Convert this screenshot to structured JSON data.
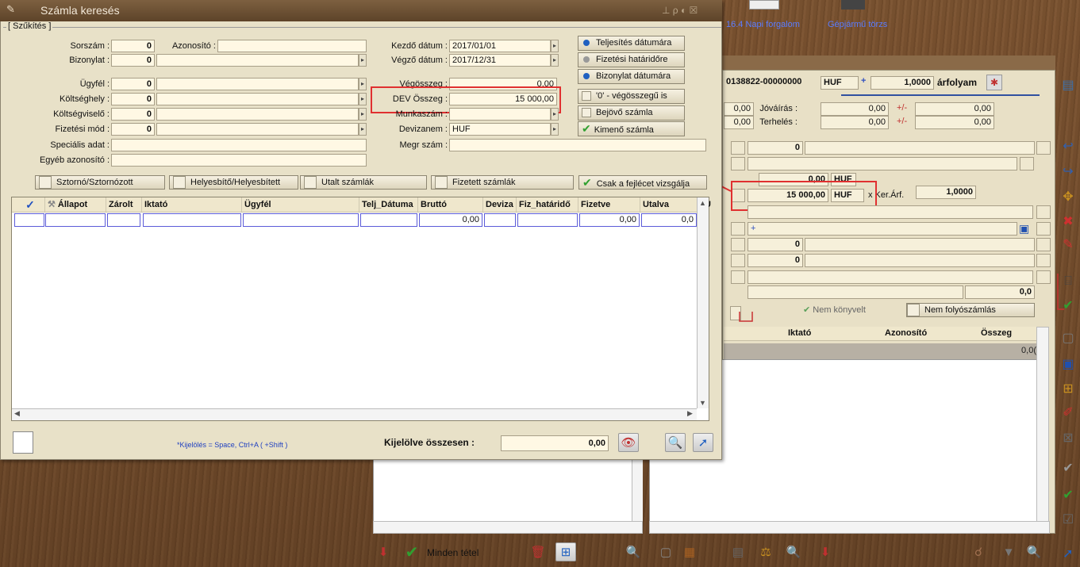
{
  "window": {
    "title": "Számla keresés",
    "ctrls": "⊥ ρ ◐ ☒"
  },
  "bg": {
    "tab1": "16.4 Napi forgalom",
    "tab2": "Gépjármű törzs"
  },
  "szukites": {
    "legend": "[ Szűkítés ]",
    "sorszam_label": "Sorszám :",
    "sorszam": "0",
    "azonosito_label": "Azonosító :",
    "azonosito": "",
    "bizonylat_label": "Bizonylat :",
    "bizonylat": "0",
    "ugyfel_label": "Ügyfél :",
    "ugyfel": "0",
    "koltseghely_label": "Költséghely :",
    "koltseghely": "0",
    "koltsegviselo_label": "Költségviselő :",
    "koltsegviselo": "0",
    "fizmod_label": "Fizetési mód :",
    "fizmod": "0",
    "specialis_label": "Speciális adat :",
    "specialis": "",
    "egyeb_label": "Egyéb azonosító :",
    "egyeb": "",
    "kezdo_label": "Kezdő dátum :",
    "kezdo": "2017/01/01",
    "vegzo_label": "Végző dátum :",
    "vegzo": "2017/12/31",
    "vegosszeg_label": "Végösszeg :",
    "vegosszeg": "0,00",
    "dev_label": "DEV Összeg :",
    "dev": "15 000,00",
    "munkaszam_label": "Munkaszám :",
    "munkaszam": "",
    "devizanem_label": "Devizanem :",
    "devizanem": "HUF",
    "megr_label": "Megr szám :",
    "megr": ""
  },
  "options": {
    "telj": "Teljesítés dátumára",
    "fiz": "Fizetési határidőre",
    "biz": "Bizonylat dátumára",
    "zero": "'0' - végösszegű is",
    "bejovo": "Bejövő számla",
    "kimeno": "Kimenő számla"
  },
  "filters": {
    "storno": "Sztornó/Sztornózott",
    "helyes": "Helyesbítő/Helyesbített",
    "utalt": "Utalt számlák",
    "fizetett": "Fizetett számlák",
    "fejlec": "Csak a fejlécet vizsgálja"
  },
  "grid": {
    "headers": [
      "✓",
      "Állapot",
      "Zárolt",
      "Iktató",
      "Ügyfél",
      "Telj_Dátuma",
      "Bruttó",
      "Deviza",
      "Fiz_határidő",
      "Fizetve",
      "Utalva",
      "U"
    ],
    "row": {
      "brutto": "0,00",
      "fizetve": "0,00",
      "utalva": "0,0"
    }
  },
  "footer": {
    "hint": "*Kijelölés = Space, Ctrl+A ( +Shift )",
    "kijelolve_label": "Kijelölve összesen :",
    "kijelolve": "0,00"
  },
  "right": {
    "doc": "0138822-00000000",
    "cur": "HUF",
    "plus": "+",
    "rate": "1,0000",
    "rate_label": "árfolyam",
    "jovairas_label": "Jóváírás :",
    "terheles_label": "Terhelés :",
    "v1": "0,00",
    "v2": "0,00",
    "v3": "0,00",
    "v4": "0,00",
    "v5": "0,00",
    "v6": "0,00",
    "pm": "+/-",
    "r_zero": "0",
    "amount1": "0,00",
    "amount1_cur": "HUF",
    "amount2": "15 000,00",
    "amount2_cur": "HUF",
    "ker_label": "x Ker.Árf.",
    "ker": "1,0000",
    "z1": "0",
    "z2": "0",
    "last": "0,0",
    "nem_konyvelt": "Nem könyvelt",
    "nem_folyo": "Nem folyószámlás",
    "col_iktato": "Iktató",
    "col_azon": "Azonosító",
    "col_osszeg": "Összeg",
    "sum": "0,0("
  },
  "bottom": {
    "minden": "Minden tétel"
  },
  "colors": {
    "accent": "#3050c0",
    "annot": "#e03030",
    "title": "#6a4f33"
  }
}
